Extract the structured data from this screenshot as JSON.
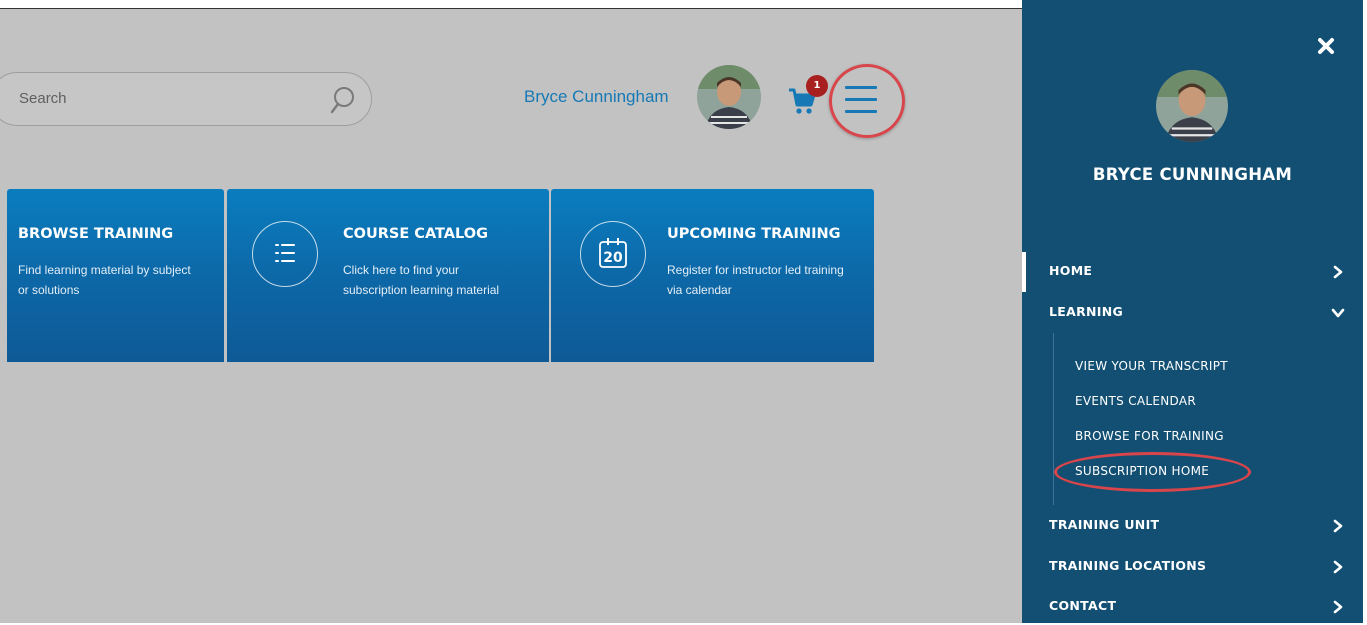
{
  "header": {
    "search": {
      "placeholder": "Search"
    },
    "user_name": "Bryce Cunningham",
    "cart_count": "1",
    "icons": [
      "search-icon",
      "avatar",
      "cart-icon",
      "menu-icon"
    ]
  },
  "cards": [
    {
      "title": "BROWSE TRAINING",
      "description": "Find learning material by subject or solutions",
      "icon": "browse-icon"
    },
    {
      "title": "COURSE CATALOG",
      "description": "Click here to find your subscription learning material",
      "icon": "list-icon"
    },
    {
      "title": "UPCOMING TRAINING",
      "description": "Register for instructor led training via calendar",
      "icon": "calendar-icon",
      "icon_text": "20"
    }
  ],
  "sidebar": {
    "user_name": "BRYCE CUNNINGHAM",
    "items": [
      {
        "label": "HOME",
        "icon": "chevron-right-icon"
      },
      {
        "label": "LEARNING",
        "icon": "chevron-down-icon",
        "expanded": true
      },
      {
        "label": "TRAINING UNIT",
        "icon": "chevron-right-icon"
      },
      {
        "label": "TRAINING LOCATIONS",
        "icon": "chevron-right-icon"
      },
      {
        "label": "CONTACT",
        "icon": "chevron-right-icon"
      }
    ],
    "learning_subitems": [
      "VIEW YOUR TRANSCRIPT",
      "EVENTS CALENDAR",
      "BROWSE FOR TRAINING",
      "SUBSCRIPTION HOME"
    ]
  },
  "colors": {
    "overlay": "#c2c2c2",
    "accent": "#1679b5",
    "card_blue": "#0d66a5",
    "sidebar": "#124f73",
    "highlight_ring": "#d8454a",
    "badge": "#a81f1f"
  }
}
